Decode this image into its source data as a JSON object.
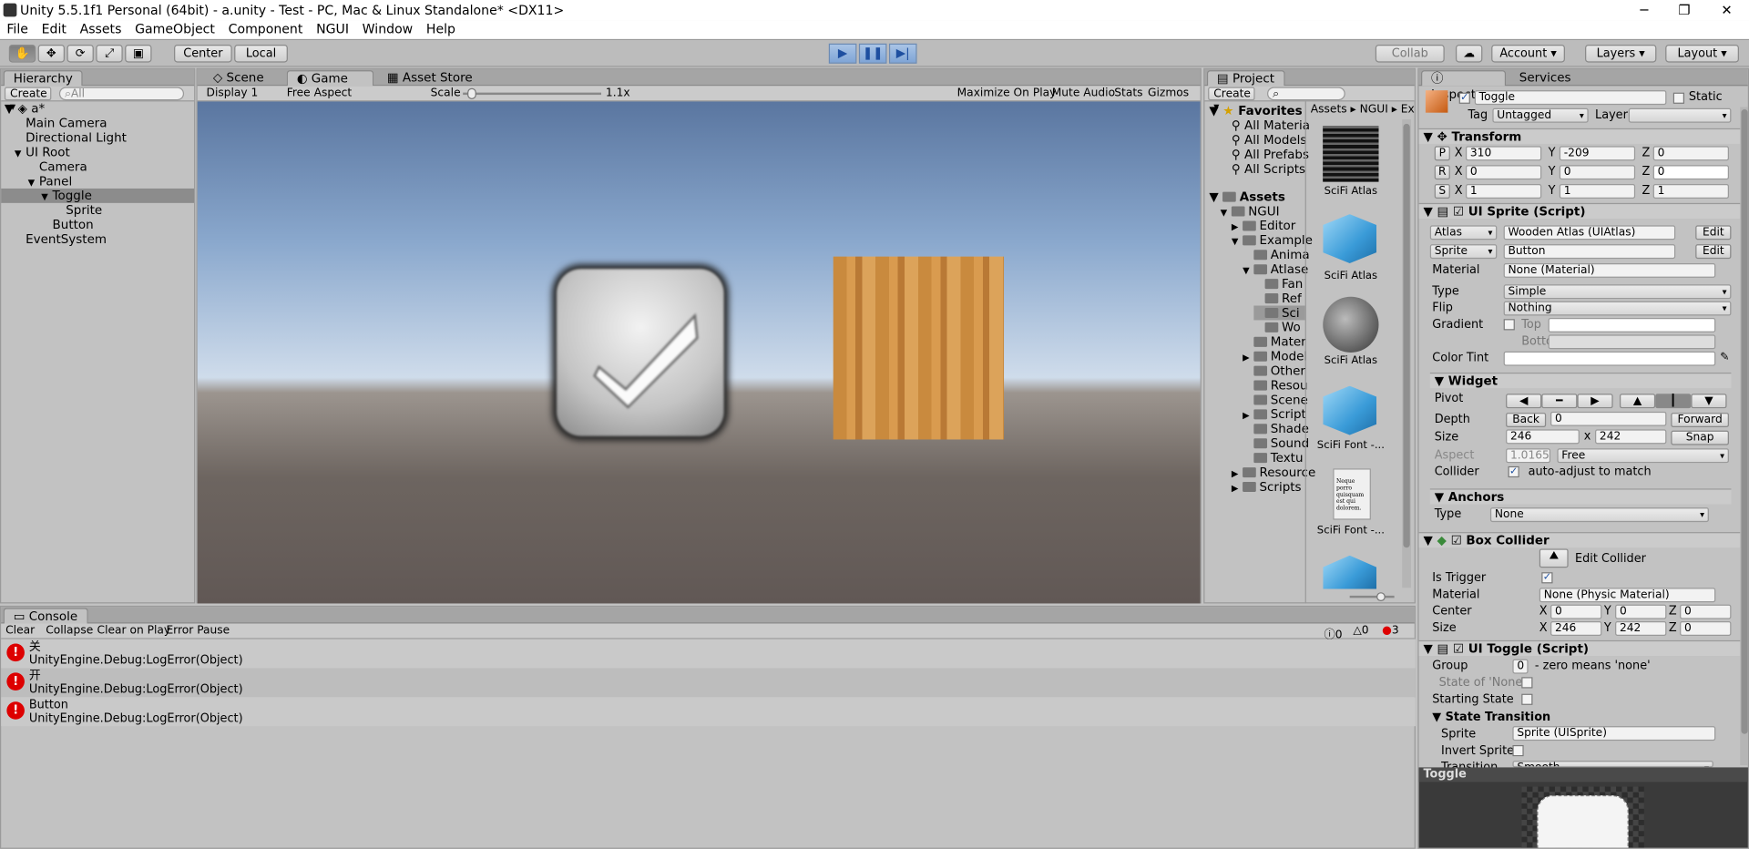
{
  "window": {
    "title": "Unity 5.5.1f1 Personal (64bit) - a.unity - Test - PC, Mac & Linux Standalone* <DX11>",
    "min": "─",
    "max": "❐",
    "close": "✕"
  },
  "menu": [
    "File",
    "Edit",
    "Assets",
    "GameObject",
    "Component",
    "NGUI",
    "Window",
    "Help"
  ],
  "toolbar": {
    "center": "Center",
    "local": "Local",
    "collab": "Collab",
    "account": "Account",
    "layers": "Layers",
    "layout": "Layout",
    "play": "▶",
    "pause": "❚❚",
    "step": "▶|"
  },
  "hierarchy": {
    "tab": "Hierarchy",
    "create": "Create",
    "search": "All",
    "scene": "a*",
    "items": [
      {
        "label": "Main Camera",
        "indent": 0,
        "arrow": ""
      },
      {
        "label": "Directional Light",
        "indent": 0,
        "arrow": ""
      },
      {
        "label": "UI Root",
        "indent": 0,
        "arrow": "▼"
      },
      {
        "label": "Camera",
        "indent": 1,
        "arrow": ""
      },
      {
        "label": "Panel",
        "indent": 1,
        "arrow": "▼"
      },
      {
        "label": "Toggle",
        "indent": 2,
        "arrow": "▼"
      },
      {
        "label": "Sprite",
        "indent": 3,
        "arrow": ""
      },
      {
        "label": "Button",
        "indent": 2,
        "arrow": ""
      },
      {
        "label": "EventSystem",
        "indent": 0,
        "arrow": ""
      }
    ]
  },
  "game": {
    "tabs": [
      "Scene",
      "Game",
      "Asset Store"
    ],
    "display": "Display 1",
    "aspect": "Free Aspect",
    "scale_label": "Scale",
    "scale_value": "1.1x",
    "buttons": [
      "Maximize On Play",
      "Mute Audio",
      "Stats",
      "Gizmos"
    ]
  },
  "project": {
    "tab": "Project",
    "create": "Create",
    "favorites": "Favorites",
    "fav_items": [
      "All Materia",
      "All Models",
      "All Prefabs",
      "All Scripts"
    ],
    "assets": "Assets",
    "tree": [
      {
        "label": "NGUI",
        "indent": 1,
        "arrow": "▼"
      },
      {
        "label": "Editor",
        "indent": 2,
        "arrow": "▶"
      },
      {
        "label": "Example",
        "indent": 2,
        "arrow": "▼"
      },
      {
        "label": "Anima",
        "indent": 3,
        "arrow": ""
      },
      {
        "label": "Atlase",
        "indent": 3,
        "arrow": "▼"
      },
      {
        "label": "Fan",
        "indent": 4,
        "arrow": ""
      },
      {
        "label": "Ref",
        "indent": 4,
        "arrow": ""
      },
      {
        "label": "Sci",
        "indent": 4,
        "arrow": ""
      },
      {
        "label": "Wo",
        "indent": 4,
        "arrow": ""
      },
      {
        "label": "Mater",
        "indent": 3,
        "arrow": ""
      },
      {
        "label": "Model",
        "indent": 3,
        "arrow": "▶"
      },
      {
        "label": "Other",
        "indent": 3,
        "arrow": ""
      },
      {
        "label": "Resou",
        "indent": 3,
        "arrow": ""
      },
      {
        "label": "Scene",
        "indent": 3,
        "arrow": ""
      },
      {
        "label": "Script",
        "indent": 3,
        "arrow": "▶"
      },
      {
        "label": "Shade",
        "indent": 3,
        "arrow": ""
      },
      {
        "label": "Sound",
        "indent": 3,
        "arrow": ""
      },
      {
        "label": "Textu",
        "indent": 3,
        "arrow": ""
      },
      {
        "label": "Resource",
        "indent": 2,
        "arrow": "▶"
      },
      {
        "label": "Scripts",
        "indent": 2,
        "arrow": "▶"
      }
    ],
    "breadcrumb": [
      "Assets",
      "NGUI",
      "Ex"
    ],
    "assets_list": [
      "SciFi Atlas",
      "SciFi Atlas",
      "SciFi Atlas",
      "SciFi Font -...",
      "SciFi Font -..."
    ],
    "font_preview": "Neque porro quisquam est qui dolorem."
  },
  "inspector": {
    "tabs": [
      "Inspector",
      "Services"
    ],
    "name": "Toggle",
    "static": "Static",
    "tag_label": "Tag",
    "tag": "Untagged",
    "layer_label": "Layer",
    "layer": "",
    "transform": {
      "title": "Transform",
      "p": [
        "310",
        "-209",
        "0"
      ],
      "r": [
        "0",
        "0",
        "0"
      ],
      "s": [
        "1",
        "1",
        "1"
      ]
    },
    "sprite": {
      "title": "UI Sprite (Script)",
      "atlas_label": "Atlas",
      "atlas": "Wooden Atlas (UIAtlas)",
      "sprite_label": "Sprite",
      "sprite": "Button",
      "edit": "Edit",
      "material_label": "Material",
      "material": "None (Material)",
      "type_label": "Type",
      "type": "Simple",
      "flip_label": "Flip",
      "flip": "Nothing",
      "gradient_label": "Gradient",
      "top": "Top",
      "bottom": "Bottom",
      "tint_label": "Color Tint"
    },
    "widget": {
      "title": "Widget",
      "pivot": "Pivot",
      "depth_label": "Depth",
      "back": "Back",
      "depth": "0",
      "forward": "Forward",
      "size_label": "Size",
      "w": "246",
      "h": "242",
      "snap": "Snap",
      "aspect_label": "Aspect",
      "aspect": "1.01652",
      "aspect_mode": "Free",
      "collider_label": "Collider",
      "collider_text": "auto-adjust to match"
    },
    "anchors": {
      "title": "Anchors",
      "type_label": "Type",
      "type": "None"
    },
    "box": {
      "title": "Box Collider",
      "edit": "Edit Collider",
      "trigger": "Is Trigger",
      "material_label": "Material",
      "material": "None (Physic Material)",
      "center_label": "Center",
      "center": [
        "0",
        "0",
        "0"
      ],
      "size_label": "Size",
      "size": [
        "246",
        "242",
        "0"
      ]
    },
    "toggle": {
      "title": "UI Toggle (Script)",
      "group_label": "Group",
      "group": "0",
      "group_hint": "- zero means 'none'",
      "state_none": "State of 'None'",
      "starting": "Starting State",
      "transition_title": "State Transition",
      "sprite_label": "Sprite",
      "sprite": "Sprite (UISprite)",
      "invert": "Invert Sprite",
      "transition_label": "Transition",
      "transition": "Smooth"
    },
    "preview": "Toggle"
  },
  "console": {
    "tab": "Console",
    "buttons": [
      "Clear",
      "Collapse",
      "Clear on Play",
      "Error Pause"
    ],
    "counts": [
      "0",
      "0",
      "3"
    ],
    "rows": [
      {
        "msg": "关",
        "detail": "UnityEngine.Debug:LogError(Object)"
      },
      {
        "msg": "开",
        "detail": "UnityEngine.Debug:LogError(Object)"
      },
      {
        "msg": "Button",
        "detail": "UnityEngine.Debug:LogError(Object)"
      }
    ]
  }
}
